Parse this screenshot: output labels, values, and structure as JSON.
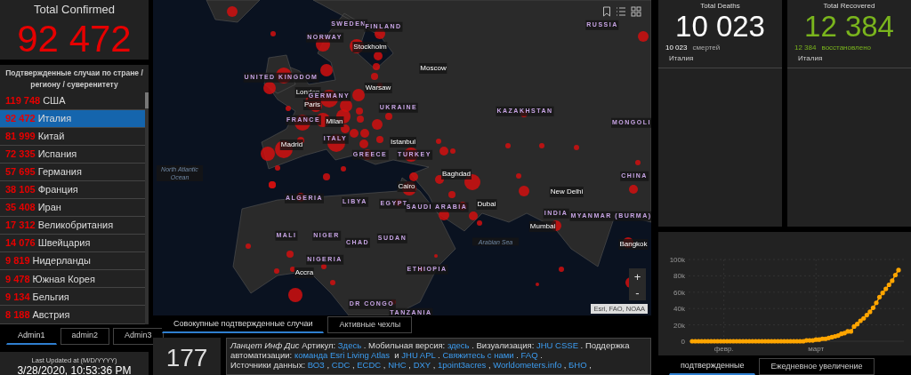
{
  "confirmed": {
    "title": "Total Confirmed",
    "value": "92 472"
  },
  "country_list": {
    "title": "Подтвержденные случаи по стране / региону / суверенитету",
    "rows": [
      {
        "count": "119 748",
        "name": "США",
        "selected": false
      },
      {
        "count": "92 472",
        "name": "Италия",
        "selected": true
      },
      {
        "count": "81 999",
        "name": "Китай",
        "selected": false
      },
      {
        "count": "72 335",
        "name": "Испания",
        "selected": false
      },
      {
        "count": "57 695",
        "name": "Германия",
        "selected": false
      },
      {
        "count": "38 105",
        "name": "Франция",
        "selected": false
      },
      {
        "count": "35 408",
        "name": "Иран",
        "selected": false
      },
      {
        "count": "17 312",
        "name": "Великобритания",
        "selected": false
      },
      {
        "count": "14 076",
        "name": "Швейцария",
        "selected": false
      },
      {
        "count": "9 819",
        "name": "Нидерланды",
        "selected": false
      },
      {
        "count": "9 478",
        "name": "Южная Корея",
        "selected": false
      },
      {
        "count": "9 134",
        "name": "Бельгия",
        "selected": false
      },
      {
        "count": "8 188",
        "name": "Австрия",
        "selected": false
      }
    ]
  },
  "admin_tabs": [
    {
      "label": "Admin1",
      "selected": true
    },
    {
      "label": "admin2",
      "selected": false
    },
    {
      "label": "Admin3",
      "selected": false
    }
  ],
  "last_updated": {
    "label": "Last Updated at (M/D/YYYY)",
    "value": "3/28/2020, 10:53:36 PM"
  },
  "map": {
    "labels": [
      {
        "text": "SWEDEN",
        "kind": "country"
      },
      {
        "text": "FINLAND",
        "kind": "country"
      },
      {
        "text": "NORWAY",
        "kind": "country"
      },
      {
        "text": "Stockholm",
        "kind": "city"
      },
      {
        "text": "RUSSIA",
        "kind": "country"
      },
      {
        "text": "Moscow",
        "kind": "city"
      },
      {
        "text": "UNITED KINGDOM",
        "kind": "country"
      },
      {
        "text": "London",
        "kind": "city"
      },
      {
        "text": "GERMANY",
        "kind": "country"
      },
      {
        "text": "Warsaw",
        "kind": "city"
      },
      {
        "text": "Paris",
        "kind": "city"
      },
      {
        "text": "UKRAINE",
        "kind": "country"
      },
      {
        "text": "KAZAKHSTAN",
        "kind": "country"
      },
      {
        "text": "FRANCE",
        "kind": "country"
      },
      {
        "text": "Milan",
        "kind": "city"
      },
      {
        "text": "MONGOLI",
        "kind": "country"
      },
      {
        "text": "ITALY",
        "kind": "country"
      },
      {
        "text": "Madrid",
        "kind": "city"
      },
      {
        "text": "Istanbul",
        "kind": "city"
      },
      {
        "text": "GREECE",
        "kind": "country"
      },
      {
        "text": "TURKEY",
        "kind": "country"
      },
      {
        "text": "North Atlantic Ocean",
        "kind": "ocean"
      },
      {
        "text": "Baghdad",
        "kind": "city"
      },
      {
        "text": "CHINA",
        "kind": "country"
      },
      {
        "text": "Cairo",
        "kind": "city"
      },
      {
        "text": "New Delhi",
        "kind": "city"
      },
      {
        "text": "ALGERIA",
        "kind": "country"
      },
      {
        "text": "LIBYA",
        "kind": "country"
      },
      {
        "text": "EGYPT",
        "kind": "country"
      },
      {
        "text": "SAUDI ARABIA",
        "kind": "country"
      },
      {
        "text": "Dubai",
        "kind": "city"
      },
      {
        "text": "INDIA",
        "kind": "country"
      },
      {
        "text": "MYANMAR (BURMA)",
        "kind": "country"
      },
      {
        "text": "Mumbai",
        "kind": "city"
      },
      {
        "text": "Arabian Sea",
        "kind": "ocean"
      },
      {
        "text": "Bangkok",
        "kind": "city"
      },
      {
        "text": "MALI",
        "kind": "country"
      },
      {
        "text": "NIGER",
        "kind": "country"
      },
      {
        "text": "CHAD",
        "kind": "country"
      },
      {
        "text": "SUDAN",
        "kind": "country"
      },
      {
        "text": "NIGERIA",
        "kind": "country"
      },
      {
        "text": "ETHIOPIA",
        "kind": "country"
      },
      {
        "text": "Accra",
        "kind": "city"
      },
      {
        "text": "DR CONGO",
        "kind": "country"
      },
      {
        "text": "TANZANIA",
        "kind": "country"
      }
    ],
    "zoom_in": "+",
    "zoom_out": "-",
    "attribution": "Esri, FAO, NOAA"
  },
  "map_tabs": [
    {
      "label": "Совокупные подтвержденные случаи",
      "selected": true
    },
    {
      "label": "Активные чехлы",
      "selected": false
    }
  ],
  "countries_count": {
    "value": "177"
  },
  "info_text": [
    {
      "kind": "italic",
      "text": "Ланцет Инф Дис"
    },
    {
      "kind": "text",
      "text": " Артикул: "
    },
    {
      "kind": "link",
      "text": "Здесь"
    },
    {
      "kind": "text",
      "text": " . Мобильная версия: "
    },
    {
      "kind": "link",
      "text": "здесь"
    },
    {
      "kind": "text",
      "text": " . Визуализация: "
    },
    {
      "kind": "link",
      "text": "JHU CSSE"
    },
    {
      "kind": "text",
      "text": " . Поддержка автоматизации: "
    },
    {
      "kind": "link",
      "text": "команда Esri Living Atlas"
    },
    {
      "kind": "text",
      "text": "  и "
    },
    {
      "kind": "link",
      "text": "JHU APL"
    },
    {
      "kind": "text",
      "text": " . "
    },
    {
      "kind": "link",
      "text": "Свяжитесь с нами"
    },
    {
      "kind": "text",
      "text": " . "
    },
    {
      "kind": "link",
      "text": "FAQ"
    },
    {
      "kind": "text",
      "text": " ."
    },
    {
      "kind": "break"
    },
    {
      "kind": "text",
      "text": "Источники данных: "
    },
    {
      "kind": "link",
      "text": "ВОЗ"
    },
    {
      "kind": "text",
      "text": " , "
    },
    {
      "kind": "link",
      "text": "CDC"
    },
    {
      "kind": "text",
      "text": " , "
    },
    {
      "kind": "link",
      "text": "ECDC"
    },
    {
      "kind": "text",
      "text": " , "
    },
    {
      "kind": "link",
      "text": "NHC"
    },
    {
      "kind": "text",
      "text": " , "
    },
    {
      "kind": "link",
      "text": "DXY"
    },
    {
      "kind": "text",
      "text": " , "
    },
    {
      "kind": "link",
      "text": "1point3acres"
    },
    {
      "kind": "text",
      "text": " , "
    },
    {
      "kind": "link",
      "text": "Worldometers.info"
    },
    {
      "kind": "text",
      "text": " , "
    },
    {
      "kind": "link",
      "text": "БНО"
    },
    {
      "kind": "text",
      "text": " ,"
    }
  ],
  "deaths": {
    "title": "Total Deaths",
    "value": "10 023",
    "detail_count": "10 023",
    "detail_label": "смертей",
    "detail_place": "Италия"
  },
  "recovered": {
    "title": "Total Recovered",
    "value": "12 384",
    "detail_count": "12 384",
    "detail_label": "восстановлено",
    "detail_place": "Италия"
  },
  "chart": {
    "chart_data": {
      "type": "line",
      "grid": true,
      "categories": [
        null,
        null,
        null,
        null,
        null,
        null,
        null,
        null,
        null,
        null,
        "февр.",
        null,
        null,
        null,
        null,
        null,
        null,
        null,
        null,
        null,
        null,
        null,
        null,
        null,
        null,
        null,
        null,
        null,
        null,
        null,
        null,
        null,
        null,
        null,
        null,
        null,
        null,
        null,
        null,
        "март",
        null,
        null,
        null,
        null,
        null,
        null,
        null,
        null,
        null,
        null,
        null,
        null,
        null,
        null,
        null,
        null,
        null,
        null,
        null,
        null,
        null,
        null,
        null,
        null,
        null,
        null
      ],
      "ylim": [
        0,
        100000
      ],
      "yticks": [
        {
          "value": 0,
          "label": "0"
        },
        {
          "value": 20000,
          "label": "20k"
        },
        {
          "value": 40000,
          "label": "40k"
        },
        {
          "value": 60000,
          "label": "60k"
        },
        {
          "value": 80000,
          "label": "80k"
        },
        {
          "value": 100000,
          "label": "100k"
        }
      ],
      "series": [
        {
          "color": "#ffa500",
          "values": [
            0,
            0,
            0,
            0,
            0,
            0,
            0,
            0,
            0,
            0,
            0,
            0,
            0,
            0,
            0,
            0,
            0,
            0,
            0,
            0,
            0,
            0,
            0,
            0,
            0,
            0,
            0,
            0,
            0,
            0,
            0,
            0,
            0,
            0,
            0,
            0,
            1000,
            1000,
            1000,
            2000,
            2000,
            3000,
            3000,
            4000,
            5000,
            6000,
            7000,
            9000,
            10000,
            12000,
            12000,
            18000,
            21000,
            25000,
            28000,
            32000,
            36000,
            41000,
            47000,
            54000,
            59000,
            64000,
            69000,
            74000,
            81000,
            87000
          ]
        }
      ]
    }
  },
  "chart_tabs": [
    {
      "label": "подтвержденные",
      "selected": true
    },
    {
      "label": "Ежедневное увеличение",
      "selected": false
    }
  ]
}
